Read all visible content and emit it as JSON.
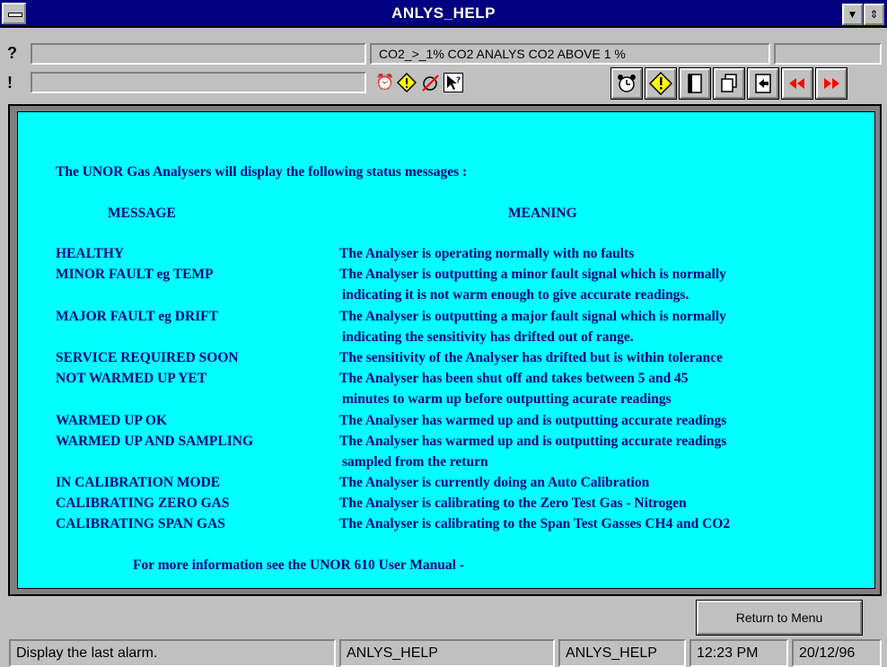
{
  "window": {
    "title": "ANLYS_HELP",
    "minimize_glyph": "▼",
    "restore_glyph": "⇕"
  },
  "alarm_rows": [
    {
      "label": "?",
      "field1": "",
      "field2": "CO2_>_1%   CO2 ANALYS CO2 ABOVE 1 %",
      "field3": ""
    },
    {
      "label": "!",
      "field1": "",
      "field2": "",
      "field3": ""
    }
  ],
  "status_icons": [
    "alarm-clock-icon",
    "warning-diamond-icon",
    "alarm-off-icon",
    "help-pointer-icon"
  ],
  "toolbar": [
    "alarm-clock-icon",
    "warning-icon",
    "page-icon",
    "copy-icon",
    "export-icon",
    "rewind-icon",
    "fast-forward-icon"
  ],
  "help": {
    "intro": "The UNOR Gas Analysers will display the following status  messages :",
    "col_message": "MESSAGE",
    "col_meaning": "MEANING",
    "rows": [
      {
        "message": "HEALTHY",
        "meaning": [
          "The Analyser is operating normally with no faults"
        ]
      },
      {
        "message": "MINOR FAULT eg TEMP",
        "meaning": [
          "The Analyser is outputting a minor fault signal which is normally",
          "indicating it is not warm enough to give accurate readings."
        ]
      },
      {
        "message": "MAJOR FAULT eg DRIFT",
        "meaning": [
          "The Analyser is outputting a major fault signal which is normally",
          "indicating the sensitivity has drifted out of range."
        ]
      },
      {
        "message": "SERVICE REQUIRED SOON",
        "meaning": [
          "The sensitivity of the Analyser has drifted but is within tolerance"
        ]
      },
      {
        "message": "NOT WARMED UP YET",
        "meaning": [
          "The Analyser has been shut off and takes between 5 and 45",
          "minutes to warm up before outputting acurate readings"
        ]
      },
      {
        "message": "WARMED UP OK",
        "meaning": [
          "The Analyser has warmed up and is outputting accurate readings"
        ]
      },
      {
        "message": "WARMED UP AND SAMPLING",
        "meaning": [
          "The Analyser has warmed up and is outputting accurate readings",
          "sampled from the return"
        ]
      },
      {
        "message": "IN CALIBRATION MODE",
        "meaning": [
          "The Analyser is currently doing an Auto Calibration"
        ]
      },
      {
        "message": "CALIBRATING ZERO GAS",
        "meaning": [
          "The Analyser is calibrating to the Zero Test Gas - Nitrogen"
        ]
      },
      {
        "message": "CALIBRATING SPAN GAS",
        "meaning": [
          "The Analyser is calibrating to the Span Test Gasses CH4 and CO2"
        ]
      }
    ],
    "footer": "For more information see the UNOR 610  User Manual  -"
  },
  "buttons": {
    "return": "Return to Menu"
  },
  "status_bar": {
    "message": "Display the last alarm.",
    "screen": "ANLYS_HELP",
    "screen2": "ANLYS_HELP",
    "time": "12:23 PM",
    "date": "20/12/96"
  },
  "colors": {
    "title_bar": "#000080",
    "panel_bg": "#00ffff",
    "help_text": "#000080",
    "chrome": "#c0c0c0"
  }
}
